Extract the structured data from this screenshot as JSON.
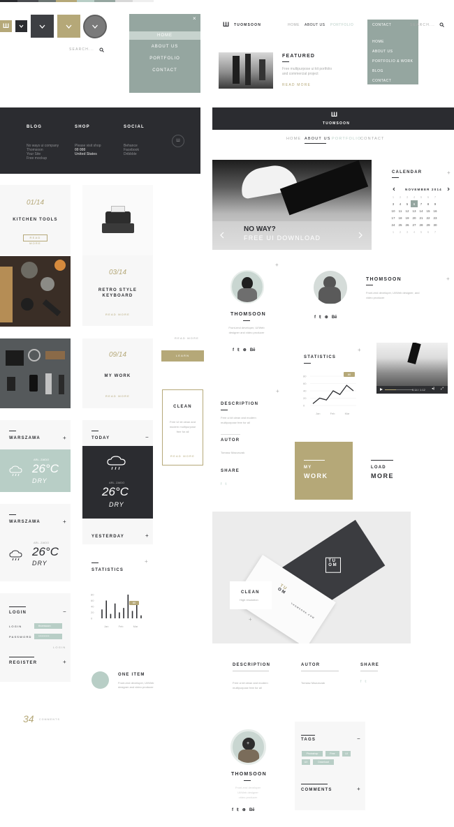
{
  "colors": {
    "dark": "#2b2c30",
    "sage": "#95a6a0",
    "khaki": "#b5a878",
    "mint": "#b8cec6",
    "light": "#f7f7f7",
    "gray": "#898989"
  },
  "brand": "TUOMSOON",
  "search_placeholder": "SEARCH...",
  "dropdown_menu": {
    "items": [
      "HOME",
      "ABOUT US",
      "PORTFOLIO",
      "CONTACT"
    ],
    "active": "HOME"
  },
  "top_nav": {
    "items": [
      "HOME",
      "ABOUT US",
      "PORTFOLIO"
    ],
    "active": "ABOUT US",
    "contact": "CONTACT",
    "sub_items": [
      "HOME",
      "ABOUT US",
      "PORTFOLIO & WORK",
      "BLOG",
      "CONTACT"
    ]
  },
  "featured": {
    "title": "FEATURED",
    "text": "Free multipurpose ui kit portfolio and commercial project",
    "read_more": "READ MORE"
  },
  "footer": {
    "blog_title": "BLOG",
    "blog_lines": [
      "No ways ui company",
      "Thomsoon",
      "Your Site",
      "Free mockup"
    ],
    "shop_title": "SHOP",
    "shop_lines": [
      "Please visit shop",
      "00 000",
      "United States"
    ],
    "social_title": "SOCIAL",
    "social_lines": [
      "Behance",
      "Facebook",
      "Dribbble"
    ]
  },
  "center_nav": {
    "items": [
      "HOME",
      "ABOUT US",
      "PORTFOLIO",
      "CONTACT"
    ],
    "active": "ABOUT US"
  },
  "cards": {
    "c1": {
      "num": "01/14",
      "title": "KITCHEN TOOLS",
      "btn": "READ MORE"
    },
    "c2": {
      "num": "03/14",
      "title1": "RETRO STYLE",
      "title2": "KEYBOARD",
      "link": "READ MORE"
    },
    "c3": {
      "num": "09/14",
      "title": "MY WORK",
      "link": "READ MORE"
    }
  },
  "read_more_small": "READ MORE",
  "khaki_button": "LEARN",
  "slider": {
    "title": "NO WAY?",
    "subtitle": "FREE UI DOWNLOAD"
  },
  "calendar": {
    "title": "CALENDAR",
    "month": "NOVEMBER 2014",
    "rows": [
      [
        "1",
        "2",
        "3",
        "4",
        "5",
        "6",
        "7"
      ],
      [
        "3",
        "4",
        "5",
        "6",
        "7",
        "8",
        "9"
      ],
      [
        "10",
        "11",
        "12",
        "13",
        "14",
        "15",
        "16"
      ],
      [
        "17",
        "18",
        "19",
        "20",
        "21",
        "22",
        "23"
      ],
      [
        "24",
        "25",
        "26",
        "27",
        "28",
        "29",
        "30"
      ],
      [
        "1",
        "2",
        "3",
        "4",
        "5",
        "6",
        "7"
      ]
    ],
    "selected": "6"
  },
  "profile1": {
    "name": "THOMSOON",
    "text": "Front-end developer, UI/Web designer and video producer"
  },
  "profile2": {
    "name": "THOMSOON",
    "text": "Front-end developer, UI/Web designer, and video producer"
  },
  "clean_card": {
    "title": "CLEAN",
    "text": "Free UI kit clean and modern multipurpose free for all",
    "link": "READ MORE"
  },
  "statistics": {
    "title": "STATISTICS",
    "badge": "80",
    "xlabels": [
      "Jan",
      "Feb",
      "Mar"
    ],
    "ylabels": [
      "80",
      "60",
      "40",
      "20",
      "0"
    ]
  },
  "chart_data": [
    {
      "type": "line",
      "title": "STATISTICS",
      "x": [
        "Jan",
        "",
        "Feb",
        "",
        "",
        "Mar",
        ""
      ],
      "values": [
        5,
        20,
        15,
        40,
        30,
        55,
        40
      ],
      "ylim": [
        0,
        80
      ]
    },
    {
      "type": "bar",
      "title": "STATISTICS",
      "x": [
        "Jan",
        "Feb",
        "Mar"
      ],
      "values": [
        30,
        60,
        15,
        50,
        20,
        35,
        80,
        25,
        45,
        10
      ],
      "ylim": [
        0,
        80
      ]
    }
  ],
  "video": {
    "time": "0:14 / 1:12"
  },
  "description": {
    "title": "DESCRIPTION",
    "text": "Free ui kit clean and modern multipurpose free for all",
    "autor_title": "AUTOR",
    "autor_text": "Tomasz Mazurczak",
    "share_title": "SHARE"
  },
  "mywork": {
    "line1": "MY",
    "line2": "WORK"
  },
  "load_more": {
    "line1": "LOAD",
    "line2": "MORE"
  },
  "weather": {
    "city": "WARSZAWA",
    "temp": "26°C",
    "state": "DRY",
    "small": "ARL. ZAIDO",
    "today": "TODAY",
    "yesterday": "YESTERDAY"
  },
  "login": {
    "title": "LOGIN",
    "login_label": "LOGIN",
    "login_value": "thomsoon",
    "password_label": "PASSWORD",
    "password_value": "**********",
    "submit": "LOGIN",
    "register": "REGISTER"
  },
  "one_item": {
    "title": "ONE ITEM",
    "text": "Front-end developer, UI/Web designer and video producer"
  },
  "comments_count": {
    "num": "34",
    "label": "COMMENTS"
  },
  "business_card": {
    "clean": "CLEAN",
    "clean_sub": "High resolution",
    "site": "THOMSOON.COM"
  },
  "bottom_desc": {
    "title": "DESCRIPTION",
    "text": "Free ui kit clean and modern multipurpose free for all",
    "autor_title": "AUTOR",
    "autor_text": "Tomasz Mazurczak",
    "share_title": "SHARE"
  },
  "profile3": {
    "name": "THOMSOON",
    "lines": [
      "Front-end developer",
      "UI/Web designer",
      "video producer"
    ]
  },
  "tags": {
    "title": "TAGS",
    "items": [
      "Photoshop",
      "Free",
      "UI",
      "UX",
      "Download"
    ],
    "comments": "COMMENTS"
  }
}
